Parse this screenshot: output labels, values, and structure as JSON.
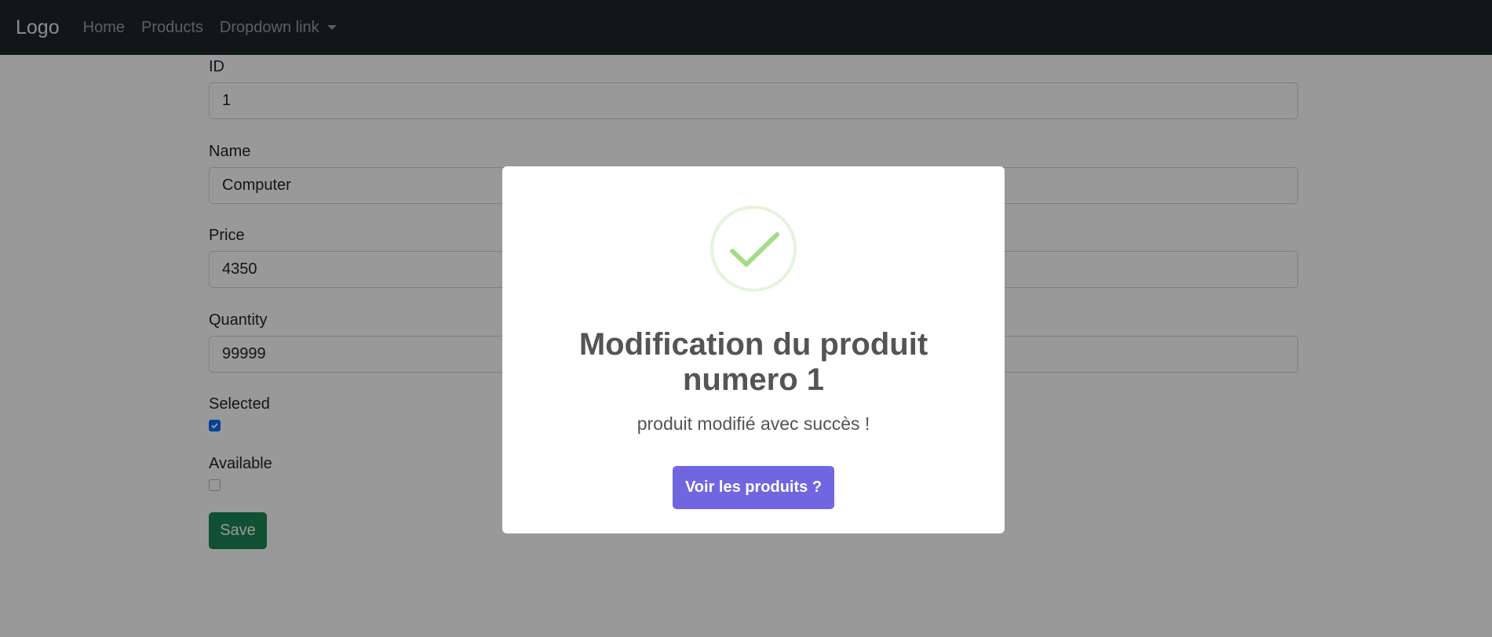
{
  "navbar": {
    "brand": "Logo",
    "links": [
      "Home",
      "Products",
      "Dropdown link"
    ]
  },
  "form": {
    "id_label": "ID",
    "id_value": "1",
    "name_label": "Name",
    "name_value": "Computer",
    "price_label": "Price",
    "price_value": "4350",
    "quantity_label": "Quantity",
    "quantity_value": "99999",
    "selected_label": "Selected",
    "selected_checked": true,
    "available_label": "Available",
    "available_checked": false,
    "save_label": "Save"
  },
  "modal": {
    "icon": "success-check-icon",
    "title": "Modification du produit numero 1",
    "text": "produit modifié avec succès !",
    "confirm_label": "Voir les produits ?"
  },
  "colors": {
    "navbar_bg": "#212529",
    "save_button": "#198754",
    "checkbox_checked": "#0d6efd",
    "confirm_button": "#7066e0",
    "success_icon": "#a5dc86"
  }
}
